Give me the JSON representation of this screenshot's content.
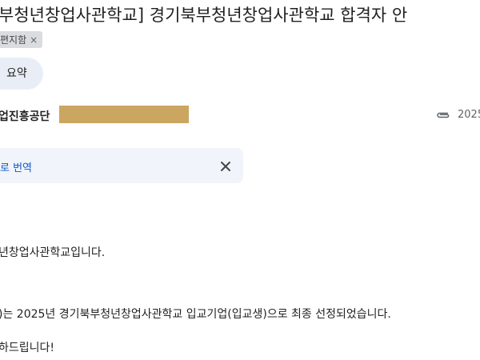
{
  "email": {
    "subject": "부청년창업사관학교] 경기북부청년창업사관학교 합격자 안",
    "label_chip": "편지함",
    "summary_button": "요약",
    "sender_name": "업진흥공단",
    "date": "2025",
    "translate_link": "로 번역",
    "body_lines": [
      "년창업사관학교입니다.",
      ")는 2025년 경기북부청년창업사관학교 입교기업(입교생)으로 최종 선정되었습니다.",
      "하드립니다!"
    ]
  },
  "colors": {
    "redaction": "#caa660",
    "link": "#0b57d0",
    "translate_bar_bg": "#f1f4fa",
    "summary_bg": "#e9eef6"
  },
  "icons": {
    "chip_remove": "close-icon",
    "attachment": "paperclip-icon",
    "translate_close": "close-icon"
  }
}
